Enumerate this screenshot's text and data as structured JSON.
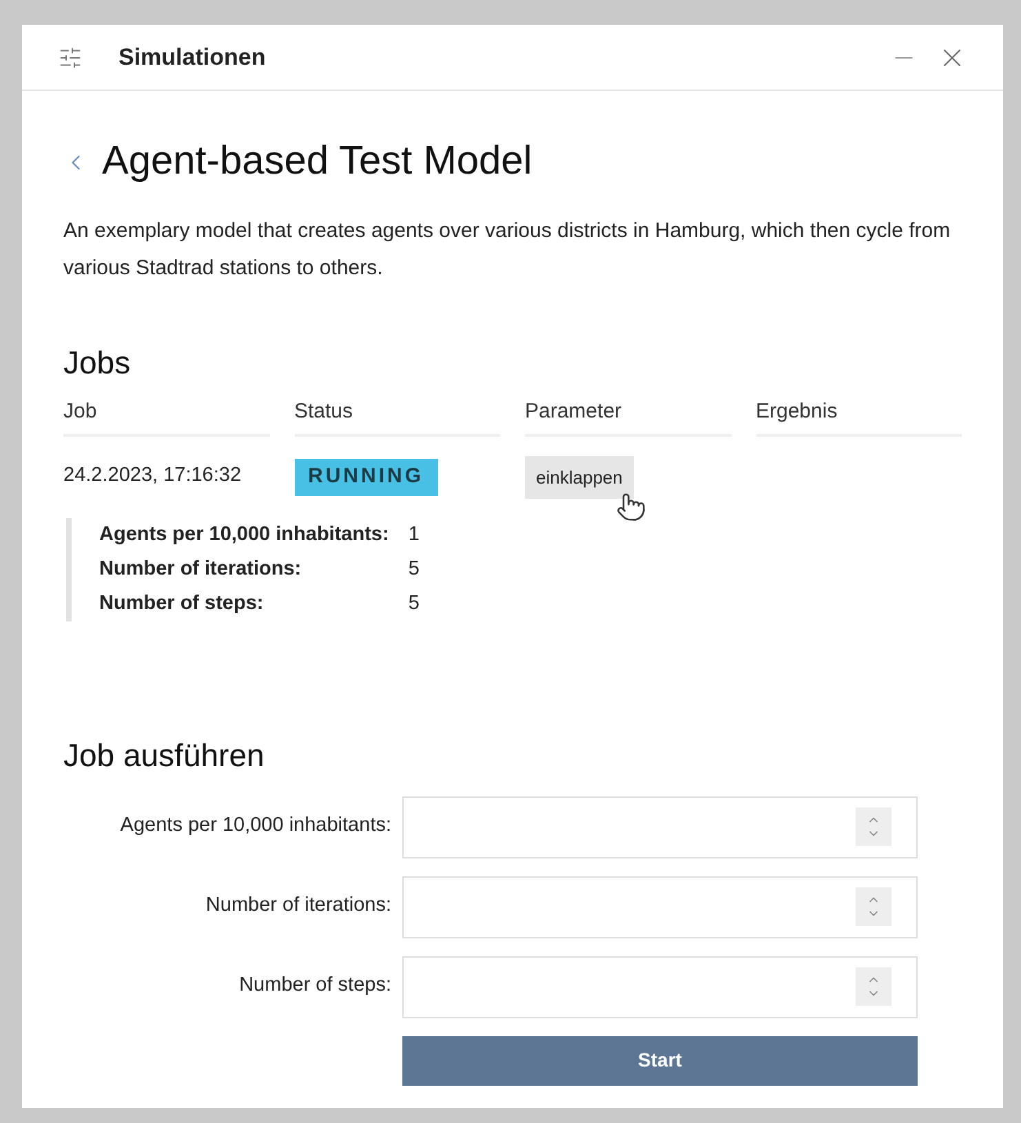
{
  "window": {
    "title": "Simulationen"
  },
  "model": {
    "title": "Agent-based Test Model",
    "description": "An exemplary model that creates agents over various districts in Hamburg, which then cycle from various Stadtrad stations to others."
  },
  "jobs": {
    "heading": "Jobs",
    "columns": [
      "Job",
      "Status",
      "Parameter",
      "Ergebnis"
    ],
    "rows": [
      {
        "job": "24.2.2023, 17:16:32",
        "status": "RUNNING",
        "toggle": "einklappen",
        "expanded": true,
        "parameters": [
          {
            "name": "Agents per 10,000 inhabitants:",
            "value": "1"
          },
          {
            "name": "Number of iterations:",
            "value": "5"
          },
          {
            "name": "Number of steps:",
            "value": "5"
          }
        ]
      }
    ]
  },
  "run_job": {
    "heading": "Job ausführen",
    "fields": [
      {
        "label": "Agents per 10,000 inhabitants:"
      },
      {
        "label": "Number of iterations:"
      },
      {
        "label": "Number of steps:"
      }
    ],
    "button": "Start"
  }
}
